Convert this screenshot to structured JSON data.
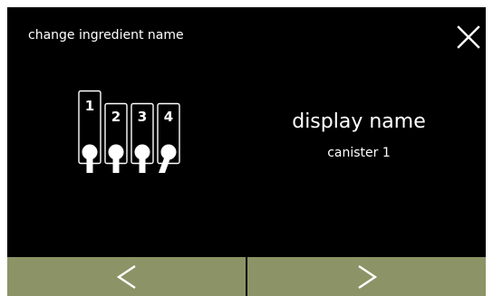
{
  "header": {
    "title": "change ingredient name"
  },
  "canisters": {
    "numbers": [
      "1",
      "2",
      "3",
      "4"
    ],
    "selected": "1"
  },
  "main": {
    "field_label": "display name",
    "field_value": "canister 1"
  },
  "icons": {
    "close": "close-icon",
    "previous": "chevron-left-icon",
    "next": "chevron-right-icon"
  },
  "colors": {
    "screen_background": "#000000",
    "nav_button": "#8c9366",
    "foreground": "#ffffff"
  }
}
